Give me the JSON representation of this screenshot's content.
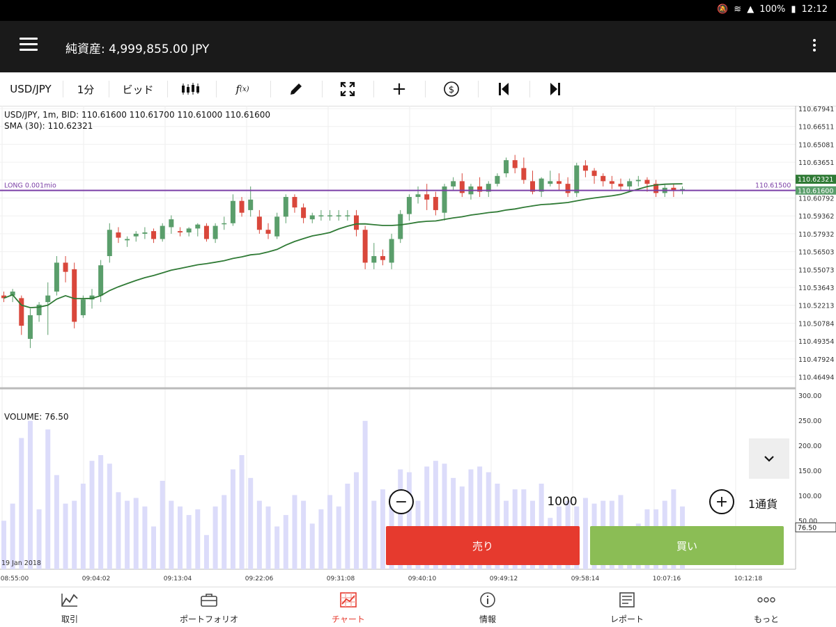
{
  "status_bar": {
    "battery": "100%",
    "time": "12:12"
  },
  "header": {
    "title": "純資産: 4,999,855.00 JPY"
  },
  "toolbar": {
    "symbol": "USD/JPY",
    "timeframe": "1分",
    "price_type": "ビッド",
    "icons": [
      "candlestick-icon",
      "function-icon",
      "pencil-icon",
      "fullscreen-icon",
      "crosshair-icon",
      "dollar-clock-icon",
      "skip-back-icon",
      "skip-forward-icon"
    ]
  },
  "chart_info": {
    "line1": "USD/JPY, 1m, BID: 110.61600 110.61700 110.61000 110.61600",
    "line2": "SMA (30): 110.62321",
    "volume_label": "VOLUME: 76.50",
    "long_label": "LONG 0.001mio",
    "position_value": "110.61500",
    "sma_value": "110.62321",
    "last_value": "110.61600",
    "volume_value": "76.50",
    "date_label": "19 Jan 2018"
  },
  "chart_data": {
    "type": "candlestick",
    "price_axis": [
      "110.67941",
      "110.66511",
      "110.65081",
      "110.63651",
      "110.62222",
      "110.60792",
      "110.59362",
      "110.57932",
      "110.56503",
      "110.55073",
      "110.53643",
      "110.52213",
      "110.50784",
      "110.49354",
      "110.47924",
      "110.46494"
    ],
    "volume_axis": [
      "300.00",
      "250.00",
      "200.00",
      "150.00",
      "100.00",
      "50.00"
    ],
    "time_axis": [
      "08:55:00",
      "09:04:02",
      "09:13:04",
      "09:22:06",
      "09:31:08",
      "09:40:10",
      "09:49:12",
      "09:58:14",
      "10:07:16",
      "10:12:18"
    ],
    "sma_period": 30,
    "long_position_price": 110.615,
    "colors": {
      "up": "#5a9e6b",
      "down": "#d9473b",
      "sma": "#2f7a35",
      "position": "#7b3fa6",
      "volume": "#dcdcfa"
    },
    "candles": [
      [
        110.535,
        110.538,
        110.53,
        110.533
      ],
      [
        110.535,
        110.54,
        110.53,
        110.538
      ],
      [
        110.533,
        110.535,
        110.505,
        110.512
      ],
      [
        110.502,
        110.525,
        110.495,
        110.52
      ],
      [
        110.52,
        110.53,
        110.515,
        110.528
      ],
      [
        110.53,
        110.545,
        110.505,
        110.535
      ],
      [
        110.538,
        110.565,
        110.535,
        110.56
      ],
      [
        110.56,
        110.565,
        110.545,
        110.553
      ],
      [
        110.555,
        110.56,
        110.51,
        110.515
      ],
      [
        110.52,
        110.535,
        110.518,
        110.532
      ],
      [
        110.532,
        110.54,
        110.525,
        110.535
      ],
      [
        110.535,
        110.562,
        110.53,
        110.558
      ],
      [
        110.565,
        110.59,
        110.56,
        110.585
      ],
      [
        110.583,
        110.587,
        110.575,
        110.579
      ],
      [
        110.577,
        110.58,
        110.572,
        110.578
      ],
      [
        110.58,
        110.584,
        110.576,
        110.582
      ],
      [
        110.582,
        110.587,
        110.578,
        110.583
      ],
      [
        110.584,
        110.586,
        110.575,
        110.578
      ],
      [
        110.578,
        110.59,
        110.576,
        110.588
      ],
      [
        110.587,
        110.596,
        110.582,
        110.593
      ],
      [
        110.584,
        110.587,
        110.58,
        110.583
      ],
      [
        110.583,
        110.587,
        110.58,
        110.586
      ],
      [
        110.586,
        110.59,
        110.58,
        110.589
      ],
      [
        110.588,
        110.59,
        110.576,
        110.578
      ],
      [
        110.578,
        110.59,
        110.575,
        110.588
      ],
      [
        110.59,
        110.595,
        110.585,
        110.59
      ],
      [
        110.59,
        110.612,
        110.588,
        110.607
      ],
      [
        110.607,
        110.61,
        110.595,
        110.598
      ],
      [
        110.6,
        110.618,
        110.595,
        110.608
      ],
      [
        110.595,
        110.6,
        110.582,
        110.585
      ],
      [
        110.585,
        110.59,
        110.578,
        110.582
      ],
      [
        110.58,
        110.598,
        110.578,
        110.595
      ],
      [
        110.595,
        110.612,
        110.59,
        110.61
      ],
      [
        110.61,
        110.612,
        110.598,
        110.602
      ],
      [
        110.602,
        110.605,
        110.59,
        110.594
      ],
      [
        110.593,
        110.598,
        110.59,
        110.596
      ],
      [
        110.596,
        110.6,
        110.592,
        110.596
      ],
      [
        110.596,
        110.6,
        110.592,
        110.596
      ],
      [
        110.596,
        110.6,
        110.592,
        110.596
      ],
      [
        110.596,
        110.6,
        110.592,
        110.596
      ],
      [
        110.596,
        110.6,
        110.58,
        110.585
      ],
      [
        110.585,
        110.588,
        110.555,
        110.56
      ],
      [
        110.56,
        110.575,
        110.555,
        110.565
      ],
      [
        110.565,
        110.57,
        110.558,
        110.562
      ],
      [
        110.56,
        110.582,
        110.555,
        110.578
      ],
      [
        110.578,
        110.6,
        110.575,
        110.597
      ],
      [
        110.597,
        110.612,
        110.592,
        110.61
      ],
      [
        110.61,
        110.618,
        110.605,
        110.612
      ],
      [
        110.612,
        110.62,
        110.6,
        110.608
      ],
      [
        110.61,
        110.614,
        110.596,
        110.6
      ],
      [
        110.598,
        110.62,
        110.592,
        110.618
      ],
      [
        110.618,
        110.625,
        110.615,
        110.622
      ],
      [
        110.622,
        110.628,
        110.61,
        110.613
      ],
      [
        110.612,
        110.62,
        110.608,
        110.618
      ],
      [
        110.618,
        110.625,
        110.61,
        110.614
      ],
      [
        110.614,
        110.622,
        110.61,
        110.62
      ],
      [
        110.62,
        110.628,
        110.618,
        110.626
      ],
      [
        110.628,
        110.64,
        110.625,
        110.638
      ],
      [
        110.638,
        110.642,
        110.628,
        110.632
      ],
      [
        110.632,
        110.64,
        110.62,
        110.623
      ],
      [
        110.622,
        110.63,
        110.612,
        110.614
      ],
      [
        110.614,
        110.625,
        110.61,
        110.624
      ],
      [
        110.62,
        110.63,
        110.618,
        110.622
      ],
      [
        110.622,
        110.628,
        110.615,
        110.62
      ],
      [
        110.62,
        110.625,
        110.61,
        110.613
      ],
      [
        110.613,
        110.636,
        110.61,
        110.634
      ],
      [
        110.634,
        110.638,
        110.625,
        110.63
      ],
      [
        110.63,
        110.632,
        110.62,
        110.626
      ],
      [
        110.626,
        110.628,
        110.618,
        110.622
      ],
      [
        110.622,
        110.626,
        110.616,
        110.62
      ],
      [
        110.62,
        110.624,
        110.615,
        110.618
      ],
      [
        110.618,
        110.624,
        110.614,
        110.622
      ],
      [
        110.622,
        110.626,
        110.618,
        110.623
      ],
      [
        110.623,
        110.625,
        110.614,
        110.62
      ],
      [
        110.62,
        110.623,
        110.61,
        110.613
      ],
      [
        110.613,
        110.62,
        110.61,
        110.617
      ],
      [
        110.617,
        110.62,
        110.61,
        110.615
      ],
      [
        110.615,
        110.618,
        110.612,
        110.616
      ]
    ],
    "volumes": [
      85,
      115,
      230,
      260,
      105,
      245,
      165,
      115,
      120,
      150,
      190,
      200,
      185,
      135,
      120,
      125,
      110,
      75,
      155,
      120,
      110,
      95,
      105,
      60,
      110,
      130,
      175,
      200,
      160,
      120,
      110,
      75,
      95,
      130,
      120,
      80,
      105,
      130,
      110,
      150,
      170,
      260,
      120,
      140,
      130,
      175,
      170,
      120,
      180,
      190,
      185,
      160,
      145,
      175,
      180,
      170,
      150,
      120,
      140,
      140,
      120,
      150,
      90,
      110,
      120,
      110,
      125,
      115,
      120,
      120,
      130,
      70,
      80,
      105,
      105,
      120,
      140,
      110
    ]
  },
  "trade_panel": {
    "quantity": "1000",
    "unit": "1通貨",
    "sell_label": "売り",
    "buy_label": "買い"
  },
  "bottom_nav": [
    {
      "label": "取引",
      "icon": "trade-chart-icon"
    },
    {
      "label": "ポートフォリオ",
      "icon": "briefcase-icon"
    },
    {
      "label": "チャート",
      "icon": "chart-grid-icon"
    },
    {
      "label": "情報",
      "icon": "info-icon"
    },
    {
      "label": "レポート",
      "icon": "report-icon"
    },
    {
      "label": "もっと",
      "icon": "more-dots-icon"
    }
  ]
}
